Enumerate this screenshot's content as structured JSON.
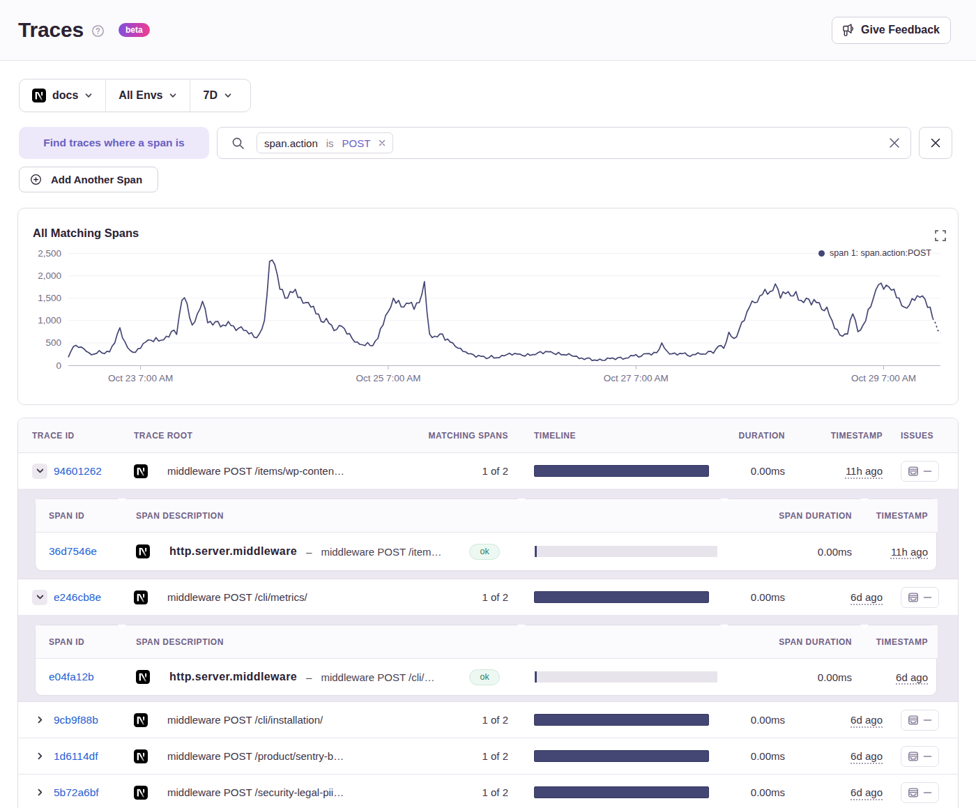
{
  "header": {
    "title": "Traces",
    "beta_label": "beta",
    "feedback_label": "Give Feedback"
  },
  "filters": {
    "project": "docs",
    "environment": "All Envs",
    "period": "7D"
  },
  "span_query": {
    "label": "Find traces where a span is",
    "token_key": "span.action",
    "token_op": "is",
    "token_value": "POST",
    "add_button": "Add Another Span"
  },
  "chart": {
    "title": "All Matching Spans",
    "legend": "span 1: span.action:POST"
  },
  "chart_data": {
    "type": "line",
    "title": "All Matching Spans",
    "series_name": "span 1: span.action:POST",
    "line_color": "#444674",
    "ylim": [
      0,
      2500
    ],
    "ytick_labels": [
      "0",
      "500",
      "1,000",
      "1,500",
      "2,000",
      "2,500"
    ],
    "xtick_labels": [
      "Oct 23 7:00 AM",
      "Oct 25 7:00 AM",
      "Oct 27 7:00 AM",
      "Oct 29 7:00 AM"
    ],
    "xtick_index": [
      28,
      124,
      220,
      316
    ],
    "dashed_from_index": 335,
    "values": [
      180,
      314,
      420,
      446,
      400,
      410,
      370,
      310,
      280,
      233,
      250,
      266,
      330,
      279,
      260,
      313,
      300,
      428,
      500,
      702,
      840,
      614,
      520,
      394,
      330,
      292,
      290,
      370,
      380,
      484,
      520,
      569,
      560,
      530,
      620,
      543,
      560,
      571,
      650,
      631,
      760,
      785,
      690,
      1122,
      1450,
      1511,
      1380,
      1065,
      900,
      970,
      1150,
      1256,
      1430,
      1268,
      950,
      982,
      900,
      977,
      980,
      860,
      900,
      880,
      980,
      890,
      880,
      775,
      830,
      862,
      780,
      775,
      700,
      730,
      630,
      616,
      700,
      807,
      1000,
      1572,
      2320,
      2353,
      2250,
      2023,
      1700,
      1691,
      1500,
      1504,
      1650,
      1625,
      1700,
      1516,
      1520,
      1387,
      1400,
      1403,
      1300,
      1321,
      1150,
      1141,
      980,
      960,
      1050,
      940,
      900,
      774,
      800,
      890,
      870,
      819,
      700,
      710,
      600,
      521,
      520,
      468,
      460,
      439,
      510,
      441,
      440,
      545,
      600,
      823,
      900,
      1116,
      1200,
      1304,
      1500,
      1386,
      1450,
      1306,
      1300,
      1388,
      1380,
      1407,
      1250,
      1396,
      1400,
      1584,
      1870,
      1191,
      700,
      619,
      650,
      634,
      700,
      699,
      560,
      587,
      520,
      500,
      420,
      384,
      380,
      308,
      300,
      257,
      260,
      235,
      180,
      223,
      200,
      200,
      150,
      169,
      220,
      161,
      170,
      169,
      220,
      213,
      240,
      270,
      230,
      267,
      250,
      253,
      220,
      204,
      260,
      222,
      240,
      240,
      280,
      307,
      260,
      309,
      300,
      306,
      270,
      242,
      290,
      235,
      240,
      228,
      260,
      216,
      200,
      206,
      150,
      163,
      130,
      160,
      160,
      108,
      120,
      106,
      140,
      109,
      110,
      163,
      150,
      165,
      130,
      172,
      180,
      136,
      160,
      164,
      220,
      212,
      240,
      185,
      200,
      257,
      260,
      264,
      230,
      291,
      280,
      359,
      500,
      387,
      320,
      253,
      260,
      274,
      230,
      266,
      260,
      278,
      220,
      200,
      240,
      238,
      280,
      251,
      250,
      249,
      310,
      313,
      270,
      365,
      430,
      442,
      380,
      522,
      740,
      640,
      600,
      634,
      800,
      963,
      1000,
      1192,
      1300,
      1436,
      1400,
      1410,
      1550,
      1580,
      1700,
      1587,
      1650,
      1667,
      1820,
      1708,
      1500,
      1641,
      1600,
      1646,
      1550,
      1550,
      1650,
      1456,
      1450,
      1402,
      1500,
      1478,
      1350,
      1471,
      1400,
      1401,
      1250,
      1220,
      1300,
      1115,
      1000,
      822,
      800,
      677,
      650,
      704,
      700,
      1006,
      1150,
      1011,
      750,
      787,
      900,
      991,
      1250,
      1312,
      1500,
      1693,
      1800,
      1836,
      1700,
      1791,
      1750,
      1679,
      1700,
      1511,
      1500,
      1331,
      1300,
      1277,
      1350,
      1492,
      1450,
      1556,
      1520,
      1551,
      1480,
      1296,
      1300,
      1051,
      950,
      784,
      720
    ]
  },
  "table": {
    "columns": [
      "TRACE ID",
      "TRACE ROOT",
      "MATCHING SPANS",
      "TIMELINE",
      "DURATION",
      "TIMESTAMP",
      "ISSUES"
    ],
    "span_columns": [
      "SPAN ID",
      "SPAN DESCRIPTION",
      "SPAN DURATION",
      "TIMESTAMP"
    ],
    "rows": [
      {
        "id": "94601262",
        "expanded": true,
        "root": "middleware POST /items/wp-conten…",
        "matching": "1 of 2",
        "duration": "0.00ms",
        "age": "11h ago",
        "spans": [
          {
            "id": "36d7546e",
            "op": "http.server.middleware",
            "desc": "middleware POST /item…",
            "status": "ok",
            "duration": "0.00ms",
            "age": "11h ago"
          }
        ]
      },
      {
        "id": "e246cb8e",
        "expanded": true,
        "root": "middleware POST /cli/metrics/",
        "matching": "1 of 2",
        "duration": "0.00ms",
        "age": "6d ago",
        "spans": [
          {
            "id": "e04fa12b",
            "op": "http.server.middleware",
            "desc": "middleware POST /cli/…",
            "status": "ok",
            "duration": "0.00ms",
            "age": "6d ago"
          }
        ]
      },
      {
        "id": "9cb9f88b",
        "expanded": false,
        "root": "middleware POST /cli/installation/",
        "matching": "1 of 2",
        "duration": "0.00ms",
        "age": "6d ago",
        "spans": []
      },
      {
        "id": "1d6114df",
        "expanded": false,
        "root": "middleware POST /product/sentry-b…",
        "matching": "1 of 2",
        "duration": "0.00ms",
        "age": "6d ago",
        "spans": []
      },
      {
        "id": "5b72a6bf",
        "expanded": false,
        "root": "middleware POST /security-legal-pii…",
        "matching": "1 of 2",
        "duration": "0.00ms",
        "age": "6d ago",
        "spans": []
      }
    ]
  }
}
